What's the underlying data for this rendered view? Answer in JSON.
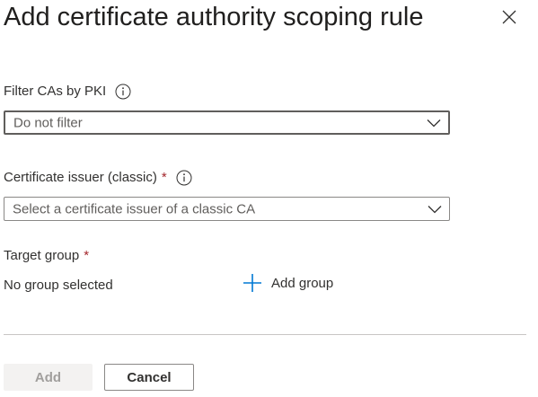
{
  "panel": {
    "title": "Add certificate authority scoping rule",
    "close_icon": "close-icon"
  },
  "filter_pki": {
    "label": "Filter CAs by PKI",
    "info_icon": "info-icon",
    "selected": "Do not filter"
  },
  "issuer": {
    "label": "Certificate issuer (classic)",
    "required_mark": "*",
    "info_icon": "info-icon",
    "placeholder": "Select a certificate issuer of a classic CA"
  },
  "target_group": {
    "label": "Target group",
    "required_mark": "*",
    "value": "No group selected",
    "add_label": "Add group",
    "add_icon": "plus-icon"
  },
  "footer": {
    "add_label": "Add",
    "cancel_label": "Cancel"
  },
  "colors": {
    "required": "#a4262c",
    "accent": "#0078d4",
    "disabled_bg": "#f3f2f1",
    "disabled_text": "#a19f9d"
  }
}
